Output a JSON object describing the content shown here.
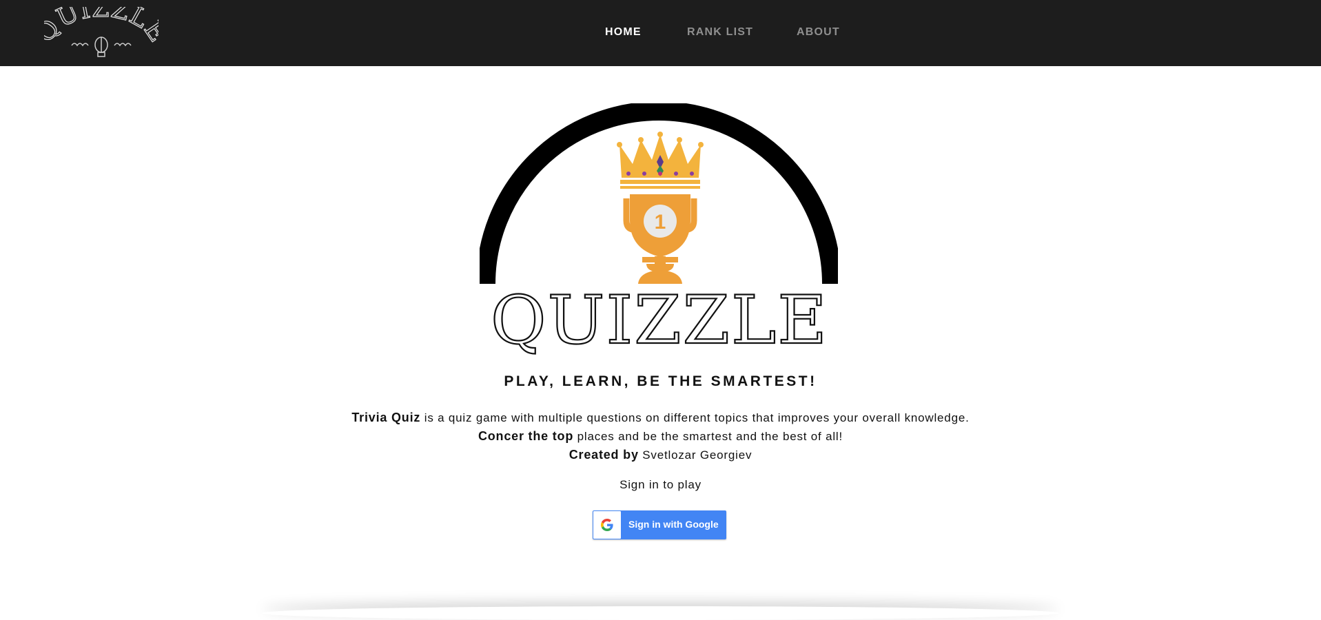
{
  "nav": {
    "logo_text": "QUIZZLE",
    "links": [
      {
        "label": "HOME",
        "active": true
      },
      {
        "label": "RANK LIST",
        "active": false
      },
      {
        "label": "ABOUT",
        "active": false
      }
    ]
  },
  "hero": {
    "logo_text": "QUIZZLE",
    "trophy_number": "1",
    "tagline": "PLAY, LEARN, BE THE SMARTEST!"
  },
  "description": {
    "line1_bold": "Trivia Quiz",
    "line1_rest": " is a quiz game with multiple questions on different topics that improves your overall knowledge.",
    "line2_bold": "Concer the top",
    "line2_rest": " places and be the smartest and the best of all!",
    "line3_bold": "Created by",
    "line3_rest": " Svetlozar Georgiev"
  },
  "signin": {
    "prompt": "Sign in to play",
    "google_button_label": "Sign in with Google"
  },
  "colors": {
    "navbar": "#1d1d1d",
    "nav_active": "#ffffff",
    "nav_inactive": "#8f8f8f",
    "trophy": "#ee9f38",
    "crown": "#f3b33d",
    "google_blue": "#4285f4"
  }
}
